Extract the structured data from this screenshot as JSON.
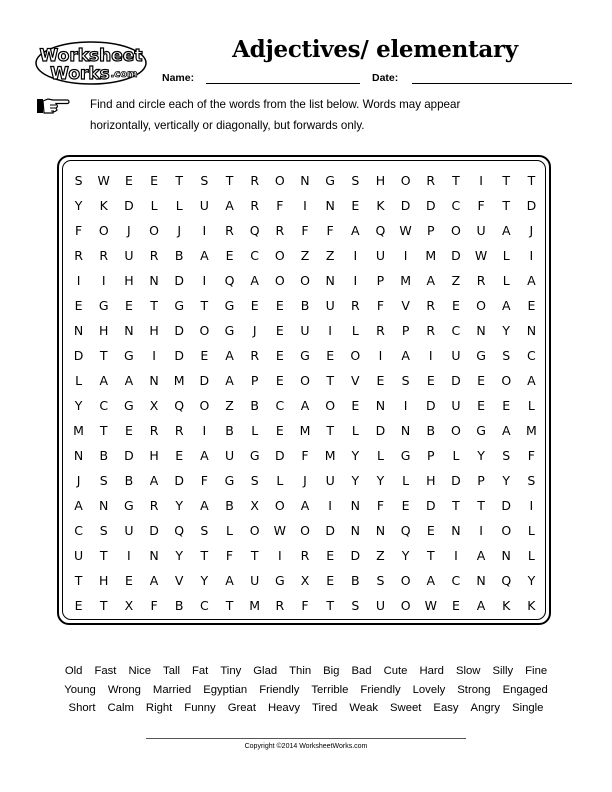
{
  "header": {
    "logo_line1": "Worksheet",
    "logo_line2": "Works",
    "logo_suffix": ".com",
    "title": "Adjectives/ elementary",
    "name_label": "Name:",
    "date_label": "Date:"
  },
  "instructions": {
    "icon": "pointing-hand-icon",
    "text_line1": "Find and circle each of the words from the list below. Words may appear",
    "text_line2": "horizontally, vertically or diagonally, but forwards only."
  },
  "puzzle": {
    "rows": [
      "SWEETSTRONGSHORTITT",
      "YKDLLUARFINEKDDCFTD",
      "FOJOJIRQRFFAQWPOUAJ",
      "RRURBAECOZZIUIMDWLI",
      "IIHNDIQAOONIPMAZRLA",
      "EGETGTGEEBURFVREOAE",
      "NHNHDOGJEUILRPRCNYN",
      "DTGIDEAREGEOIAIUGSC",
      "LAANMDAPEOTVESEDEOA",
      "YCGXQOZBCAOENIDUEEL",
      "MTERRIBLEMTLDNBOGAM",
      "NBDHEAUGDFMYLGPLYSF",
      "JSBADFGSLJUYYLHDPYS",
      "ANGRYABXOAINFEDTTDI",
      "CSUDQSLOWODNNQENIOL",
      "UTINYTFTIREDZYTIANL",
      "THEAVYAUGXEBSOACNQY",
      "ETXFBCTMRFTSUOWEAKK"
    ]
  },
  "word_list": {
    "rows": [
      [
        "Old",
        "Fast",
        "Nice",
        "Tall",
        "Fat",
        "Tiny",
        "Glad",
        "Thin",
        "Big",
        "Bad",
        "Cute",
        "Hard",
        "Slow",
        "Silly",
        "Fine"
      ],
      [
        "Young",
        "Wrong",
        "Married",
        "Egyptian",
        "Friendly",
        "Terrible",
        "Friendly",
        "Lovely",
        "Strong",
        "Engaged"
      ],
      [
        "Short",
        "Calm",
        "Right",
        "Funny",
        "Great",
        "Heavy",
        "Tired",
        "Weak",
        "Sweet",
        "Easy",
        "Angry",
        "Single"
      ]
    ]
  },
  "footer": {
    "copyright": "Copyright ©2014 WorksheetWorks.com"
  }
}
